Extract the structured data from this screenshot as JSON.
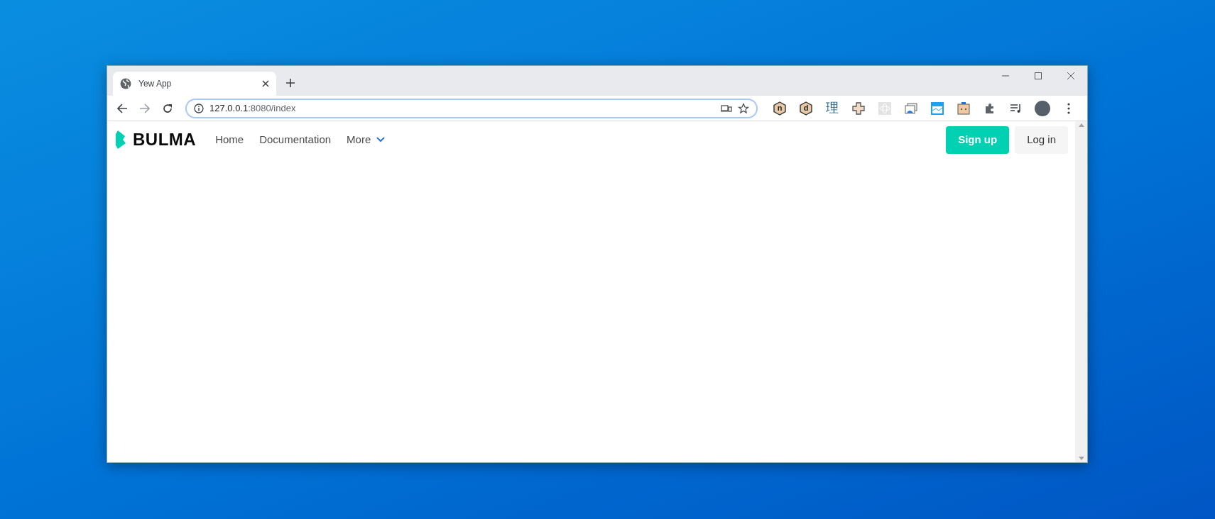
{
  "browser": {
    "tabs": [
      {
        "title": "Yew App",
        "selected": true
      }
    ],
    "address": {
      "host": "127.0.0.1",
      "path": ":8080/index"
    },
    "extensions": [
      {
        "kind": "hex",
        "glyph": "n"
      },
      {
        "kind": "hex",
        "glyph": "d"
      },
      {
        "kind": "char",
        "glyph": "理"
      },
      {
        "kind": "cross"
      },
      {
        "kind": "atom"
      },
      {
        "kind": "photos"
      },
      {
        "kind": "window"
      },
      {
        "kind": "face"
      },
      {
        "kind": "puzzle"
      },
      {
        "kind": "playlist"
      }
    ]
  },
  "navbar": {
    "brand": "BULMA",
    "links": [
      {
        "label": "Home",
        "dropdown": false
      },
      {
        "label": "Documentation",
        "dropdown": false
      },
      {
        "label": "More",
        "dropdown": true
      }
    ],
    "buttons": [
      {
        "label": "Sign up",
        "kind": "primary"
      },
      {
        "label": "Log in",
        "kind": "light"
      }
    ]
  }
}
